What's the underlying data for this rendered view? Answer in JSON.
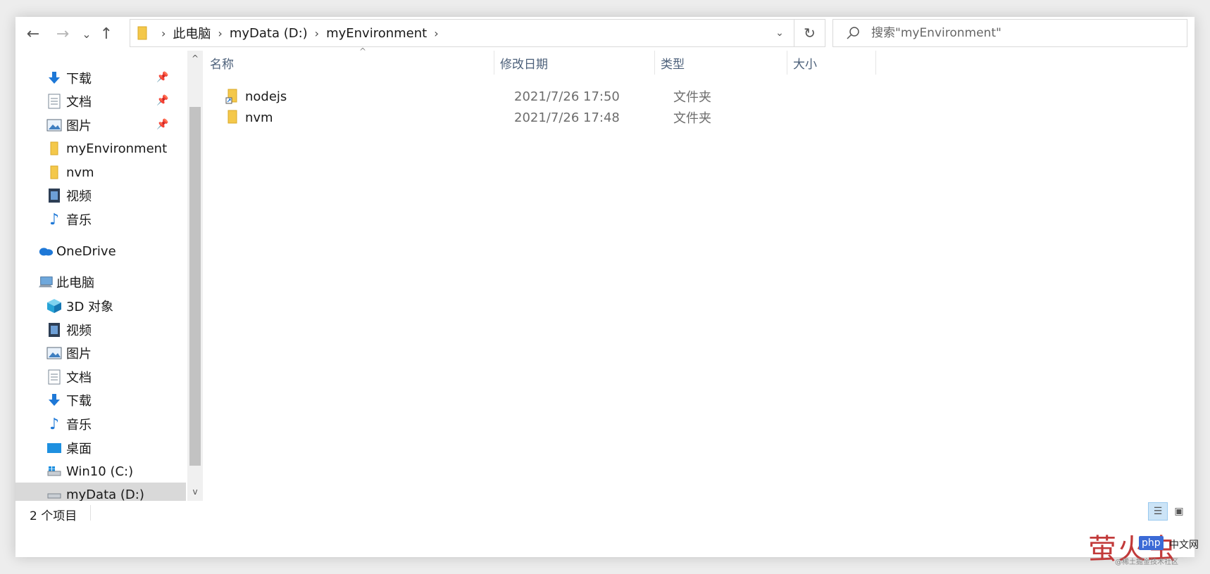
{
  "toolbar": {
    "back_glyph": "←",
    "forward_glyph": "→",
    "recent_glyph": "⌄",
    "up_glyph": "↑",
    "refresh_glyph": "↻",
    "address_dropdown_glyph": "⌄",
    "breadcrumbs": [
      "此电脑",
      "myData (D:)",
      "myEnvironment"
    ],
    "search_placeholder": "搜索\"myEnvironment\""
  },
  "sidebar": {
    "quick_access": [
      {
        "label": "下载",
        "icon": "download-icon",
        "pinned": true
      },
      {
        "label": "文档",
        "icon": "document-icon",
        "pinned": true
      },
      {
        "label": "图片",
        "icon": "picture-icon",
        "pinned": true
      },
      {
        "label": "myEnvironment",
        "icon": "folder-icon",
        "pinned": false
      },
      {
        "label": "nvm",
        "icon": "folder-icon",
        "pinned": false
      },
      {
        "label": "视频",
        "icon": "video-icon",
        "pinned": false
      },
      {
        "label": "音乐",
        "icon": "music-icon",
        "pinned": false
      }
    ],
    "onedrive": {
      "label": "OneDrive",
      "icon": "cloud-icon"
    },
    "this_pc": {
      "label": "此电脑",
      "icon": "computer-icon"
    },
    "this_pc_items": [
      {
        "label": "3D 对象",
        "icon": "cube-icon"
      },
      {
        "label": "视频",
        "icon": "video-icon"
      },
      {
        "label": "图片",
        "icon": "picture-icon"
      },
      {
        "label": "文档",
        "icon": "document-icon"
      },
      {
        "label": "下载",
        "icon": "download-icon"
      },
      {
        "label": "音乐",
        "icon": "music-icon"
      },
      {
        "label": "桌面",
        "icon": "desktop-icon"
      },
      {
        "label": "Win10 (C:)",
        "icon": "windows-drive-icon"
      },
      {
        "label": "myData (D:)",
        "icon": "drive-icon",
        "selected": true
      }
    ],
    "pin_glyph": "📌",
    "scroll_up_glyph": "^",
    "scroll_down_glyph": "v"
  },
  "columns": {
    "name": "名称",
    "date": "修改日期",
    "type": "类型",
    "size": "大小",
    "sort_glyph": "^"
  },
  "files": [
    {
      "name": "nodejs",
      "date": "2021/7/26 17:50",
      "type": "文件夹",
      "size": "",
      "icon": "folder-shortcut-icon"
    },
    {
      "name": "nvm",
      "date": "2021/7/26 17:48",
      "type": "文件夹",
      "size": "",
      "icon": "folder-icon"
    }
  ],
  "status": {
    "item_count": "2 个项目"
  },
  "watermark": {
    "big_text": "萤火虫",
    "php": "php",
    "cn": "中文网",
    "sub": "@稀土掘金技术社区"
  },
  "colors": {
    "folder": "#f4c84a",
    "accent": "#1e78d7",
    "header_text": "#4c607a",
    "selected_bg": "#d9d9d9"
  }
}
